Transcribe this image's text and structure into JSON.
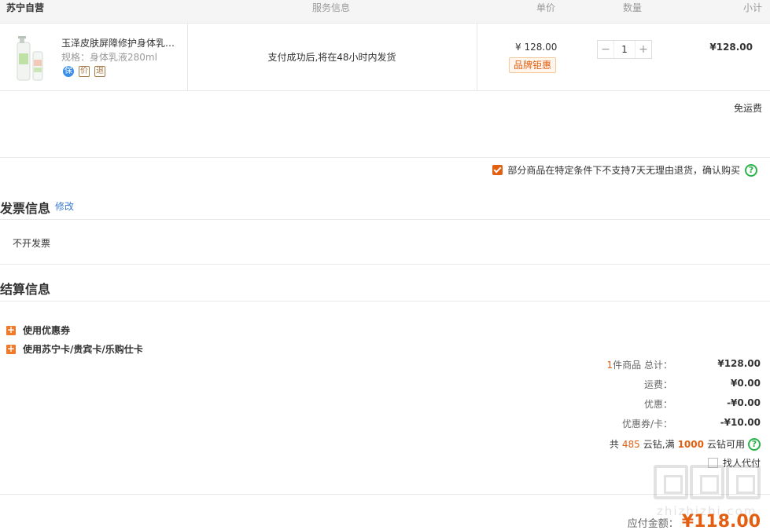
{
  "table_head": {
    "store": "苏宁自营",
    "service": "服务信息",
    "unit_price": "单价",
    "quantity": "数量",
    "subtotal": "小计"
  },
  "item": {
    "name": "玉泽皮肤屏障修护身体乳液280ml",
    "spec": "规格：身体乳液280ml",
    "tags": [
      "保",
      "价",
      "退"
    ],
    "service_text": "支付成功后,将在48小时内发货",
    "unit_price": "¥ 128.00",
    "promo_badge": "品牌钜惠",
    "minus": "−",
    "qty": "1",
    "plus": "+",
    "subtotal": "¥128.00"
  },
  "free_shipping": "免运费",
  "confirm_text": "部分商品在特定条件下不支持7天无理由退货，确认购买",
  "help_glyph": "?",
  "invoice": {
    "title": "发票信息",
    "edit": "修改",
    "value": "不开发票"
  },
  "settlement": {
    "title": "结算信息",
    "options": [
      "使用优惠券",
      "使用苏宁卡/贵宾卡/乐购仕卡"
    ],
    "plus_glyph": "+"
  },
  "summary": {
    "count": "1",
    "count_suffix": "件商品 总计：",
    "total": "¥128.00",
    "shipping_label": "运费：",
    "shipping": "¥0.00",
    "discount_label": "优惠：",
    "discount": "-¥0.00",
    "coupon_label": "优惠券/卡：",
    "coupon": "-¥10.00",
    "points_prefix": "共",
    "points_have": "485",
    "points_mid": "云钻,满",
    "points_min": "1000",
    "points_suffix": "云钻可用",
    "agent_pay": "找人代付"
  },
  "payable": {
    "label": "应付金额：",
    "value": "¥118.00"
  },
  "watermark": "zhizhizhi.com",
  "colors": {
    "accent": "#e25f12",
    "link": "#3b7bd4",
    "help": "#2bb34a"
  }
}
